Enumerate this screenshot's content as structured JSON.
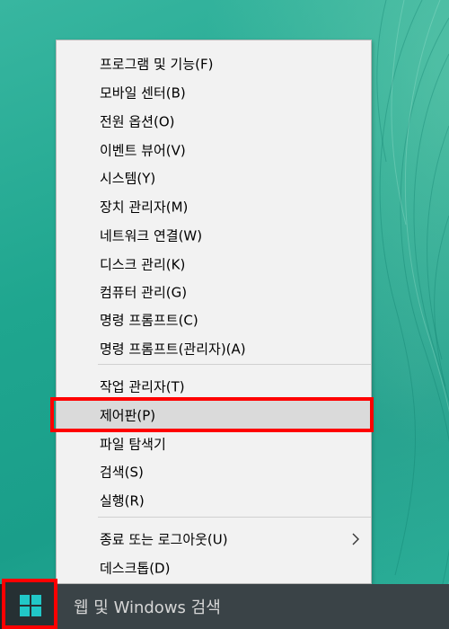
{
  "menu": {
    "items": [
      {
        "label": "프로그램 및 기능(F)"
      },
      {
        "label": "모바일 센터(B)"
      },
      {
        "label": "전원 옵션(O)"
      },
      {
        "label": "이벤트 뷰어(V)"
      },
      {
        "label": "시스템(Y)"
      },
      {
        "label": "장치 관리자(M)"
      },
      {
        "label": "네트워크 연결(W)"
      },
      {
        "label": "디스크 관리(K)"
      },
      {
        "label": "컴퓨터 관리(G)"
      },
      {
        "label": "명령 프롬프트(C)"
      },
      {
        "label": "명령 프롬프트(관리자)(A)"
      },
      {
        "label": "작업 관리자(T)"
      },
      {
        "label": "제어판(P)"
      },
      {
        "label": "파일 탐색기"
      },
      {
        "label": "검색(S)"
      },
      {
        "label": "실행(R)"
      },
      {
        "label": "종료 또는 로그아웃(U)"
      },
      {
        "label": "데스크톱(D)"
      }
    ],
    "highlighted_item": "제어판(P)"
  },
  "taskbar": {
    "start_icon": "windows-logo-icon",
    "search_placeholder": "웹 및 Windows 검색"
  },
  "colors": {
    "highlight_outline": "#ff0000",
    "taskbar": "#1c2326",
    "search_box": "#3a4347",
    "menu_background": "#f2f2f2",
    "windows_logo": "#21c7c7"
  }
}
